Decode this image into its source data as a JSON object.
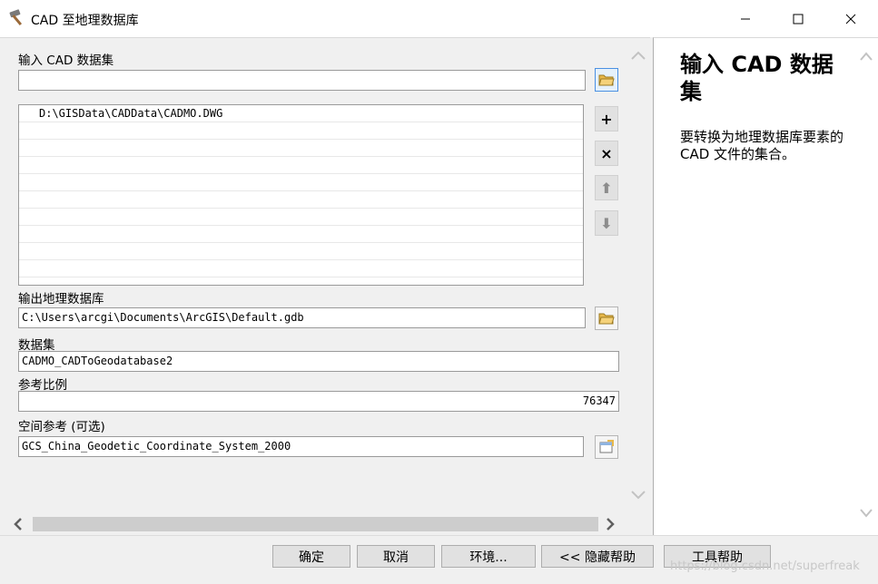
{
  "window": {
    "title": "CAD 至地理数据库",
    "minimize_icon": "minimize-icon",
    "maximize_icon": "maximize-icon",
    "close_icon": "close-icon"
  },
  "form": {
    "input_cad_label": "输入 CAD 数据集",
    "input_cad_value": "",
    "input_list": [
      "D:\\GISData\\CADData\\CADMO.DWG",
      "",
      "",
      "",
      "",
      "",
      "",
      "",
      "",
      ""
    ],
    "output_gdb_label": "输出地理数据库",
    "output_gdb_value": "C:\\Users\\arcgi\\Documents\\ArcGIS\\Default.gdb",
    "dataset_label": "数据集",
    "dataset_value": "CADMO_CADToGeodatabase2",
    "scale_label": "参考比例",
    "scale_value": "76347",
    "spatial_ref_label": "空间参考 (可选)",
    "spatial_ref_value": "GCS_China_Geodetic_Coordinate_System_2000",
    "add_glyph": "+",
    "remove_glyph": "×",
    "up_glyph": "⬆",
    "down_glyph": "⬇"
  },
  "help": {
    "title": "输入 CAD 数据集",
    "description": "要转换为地理数据库要素的 CAD 文件的集合。"
  },
  "buttons": {
    "ok": "确定",
    "cancel": "取消",
    "environments": "环境...",
    "hide_help": "<< 隐藏帮助",
    "tool_help": "工具帮助"
  },
  "watermark": "https://blog.csdn.net/superfreak",
  "colors": {
    "accent": "#4a90e2",
    "folder": "#e8b84a"
  }
}
